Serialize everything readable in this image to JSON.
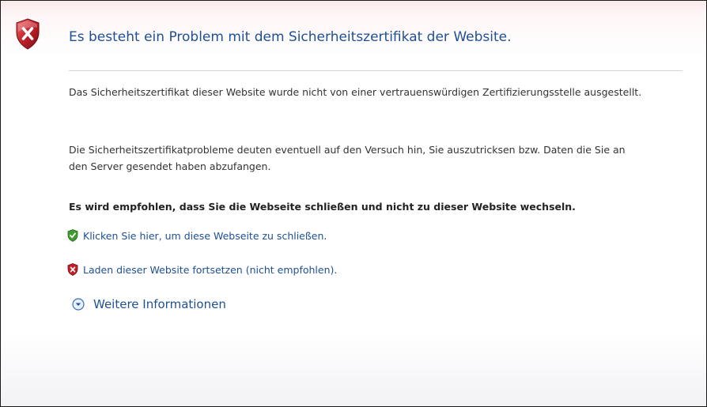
{
  "error_page": {
    "title": "Es besteht ein Problem mit dem Sicherheitszertifikat der Website.",
    "paragraph_1": "Das Sicherheitszertifikat dieser Website wurde nicht von einer vertrauenswürdigen Zertifizierungsstelle ausgestellt.",
    "paragraph_2": "Die Sicherheitszertifikatprobleme deuten eventuell auf den Versuch hin, Sie auszutricksen bzw. Daten die Sie an den Server gesendet haben abzufangen.",
    "recommendation": "Es wird empfohlen, dass Sie die Webseite schließen und nicht zu dieser Website wechseln.",
    "actions": [
      {
        "label": "Klicken Sie hier, um diese Webseite zu schließen.",
        "icon": "green-shield-check-icon"
      },
      {
        "label": "Laden dieser Website fortsetzen (nicht empfohlen).",
        "icon": "red-shield-x-icon"
      }
    ],
    "more_info": "Weitere Informationen",
    "main_icon": "red-shield-x-icon"
  },
  "colors": {
    "title_blue": "#1f4f94",
    "link_blue": "#1f4f94",
    "shield_red": "#c0202a",
    "shield_green": "#3f9b2e",
    "divider": "#d4d4d4"
  }
}
